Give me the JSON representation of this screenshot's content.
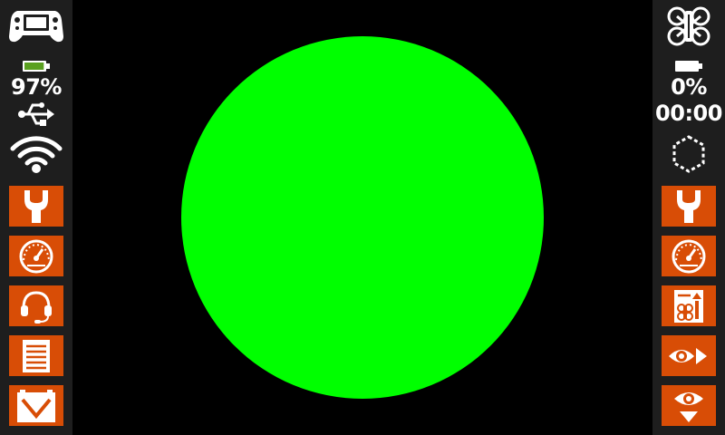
{
  "left": {
    "battery_text": "97%",
    "battery_fraction": 0.97
  },
  "right": {
    "battery_text": "0%",
    "battery_fraction": 0.0,
    "timer": "00:00"
  },
  "colors": {
    "button_bg": "#d84d06",
    "sidebar_bg": "#1e1e1e",
    "battery_fill": "#5aa020",
    "video_fill": "#00ff00"
  }
}
